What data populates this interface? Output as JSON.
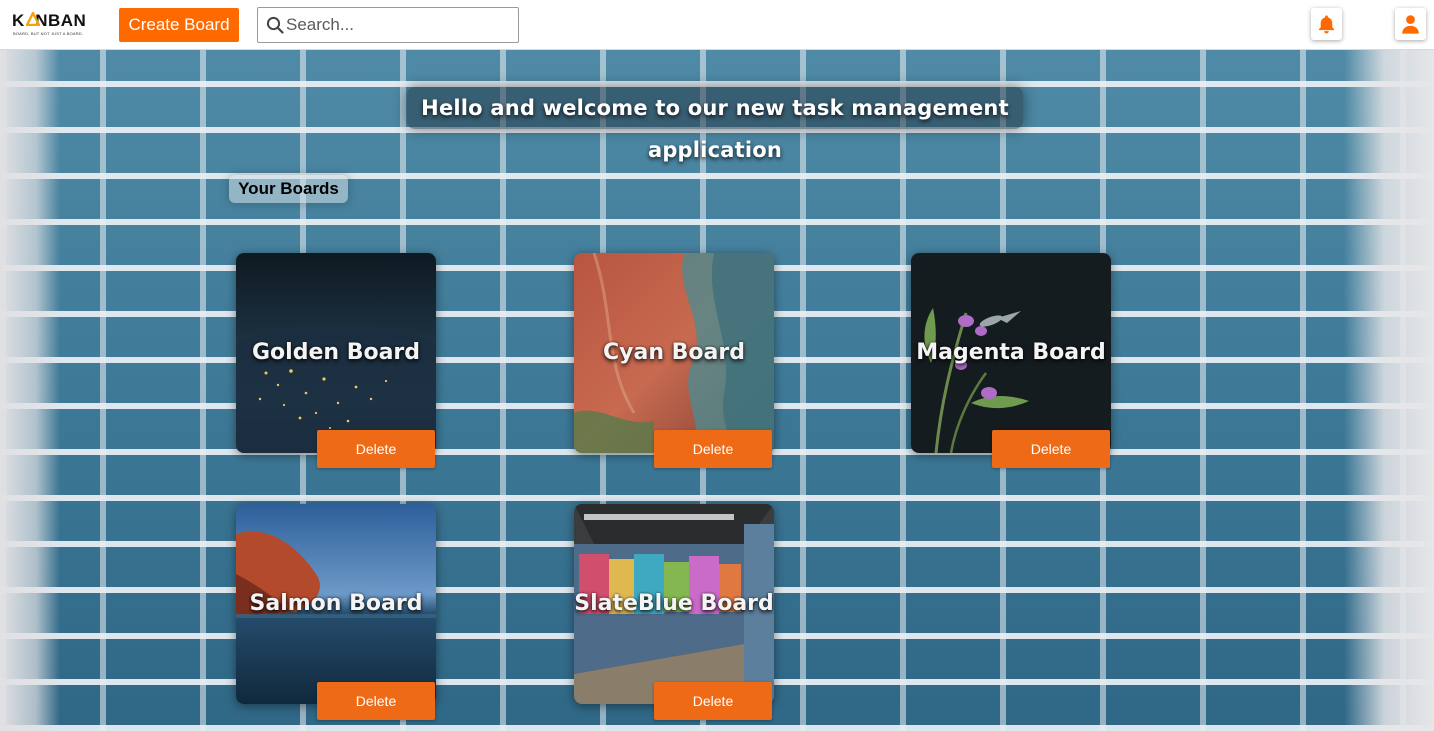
{
  "header": {
    "logo": {
      "word": "KANBAN",
      "tagline": "BOARD, BUT NOT JUST A BOARD.",
      "accent": "#f5a20a"
    },
    "create_board_label": "Create Board",
    "search": {
      "placeholder": "Search...",
      "value": ""
    },
    "notification_icon": "bell-icon",
    "profile_icon": "user-icon",
    "accent_color": "#ff6a00"
  },
  "main": {
    "welcome_text": "Hello and welcome to our new task management application",
    "section_title": "Your Boards",
    "boards": [
      {
        "title": "Golden Board",
        "image": "earth-night-lights",
        "delete_label": "Delete"
      },
      {
        "title": "Cyan Board",
        "image": "red-canyon-aerial",
        "delete_label": "Delete"
      },
      {
        "title": "Magenta Board",
        "image": "flowers-hummingbird",
        "delete_label": "Delete"
      },
      {
        "title": "Salmon Board",
        "image": "sea-cliff",
        "delete_label": "Delete"
      },
      {
        "title": "SlateBlue Board",
        "image": "graffiti-tunnel",
        "delete_label": "Delete"
      }
    ]
  }
}
